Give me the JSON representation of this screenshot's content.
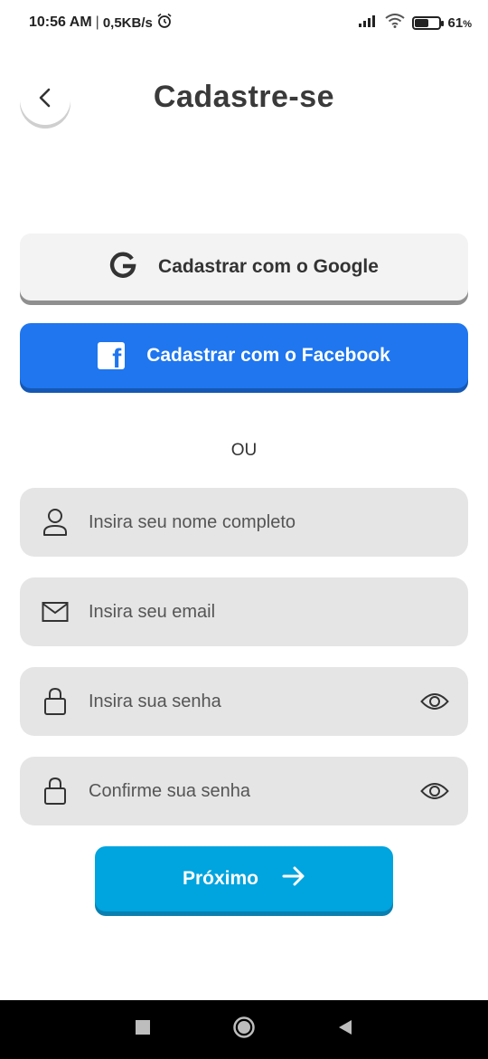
{
  "status_bar": {
    "time": "10:56 AM",
    "separator": "|",
    "speed": "0,5KB/s",
    "battery_percent": "61",
    "battery_unit": "%",
    "battery_level": 0.61
  },
  "header": {
    "title": "Cadastre-se"
  },
  "social": {
    "google_label": "Cadastrar com o Google",
    "facebook_label": "Cadastrar com o Facebook"
  },
  "divider": {
    "text": "OU"
  },
  "form": {
    "name_placeholder": "Insira seu nome completo",
    "email_placeholder": "Insira seu email",
    "password_placeholder": "Insira sua senha",
    "confirm_placeholder": "Confirme sua senha"
  },
  "next_button": {
    "label": "Próximo"
  },
  "colors": {
    "facebook": "#1f76ef",
    "next": "#00a4de",
    "field_bg": "#e5e5e5"
  },
  "icons": [
    "back-chevron-icon",
    "google-icon",
    "facebook-icon",
    "user-icon",
    "envelope-icon",
    "lock-icon",
    "eye-icon",
    "arrow-right-icon"
  ]
}
